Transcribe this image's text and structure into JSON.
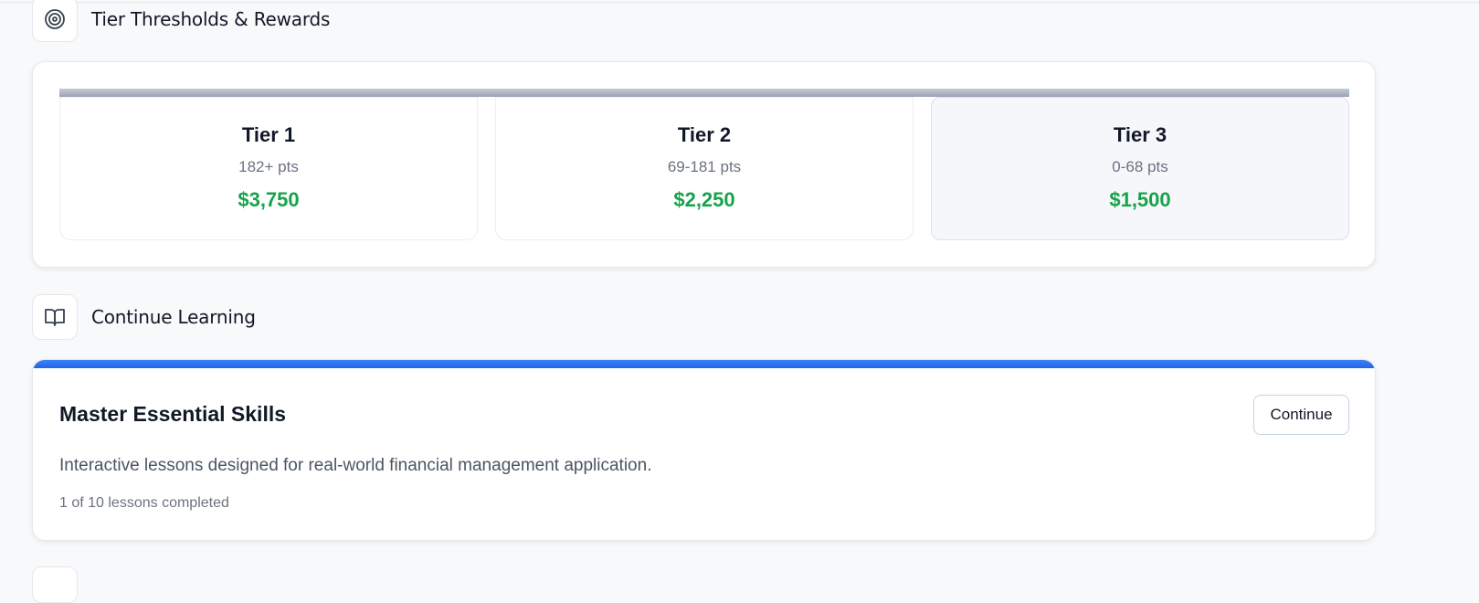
{
  "tier_section": {
    "title": "Tier Thresholds & Rewards",
    "icon": "target-icon",
    "tiers": [
      {
        "name": "Tier 1",
        "range": "182+ pts",
        "reward": "$3,750",
        "current": false
      },
      {
        "name": "Tier 2",
        "range": "69-181 pts",
        "reward": "$2,250",
        "current": false
      },
      {
        "name": "Tier 3",
        "range": "0-68 pts",
        "reward": "$1,500",
        "current": true
      }
    ]
  },
  "learning_section": {
    "title": "Continue Learning",
    "icon": "book-open-icon",
    "course": {
      "title": "Master Essential Skills",
      "button_label": "Continue",
      "description": "Interactive lessons designed for real-world financial management application.",
      "progress_text": "1 of 10 lessons completed"
    }
  },
  "colors": {
    "reward_green": "#16a34a",
    "accent_blue": "#2563eb",
    "tier_bar_gray": "#9aa2b2"
  }
}
